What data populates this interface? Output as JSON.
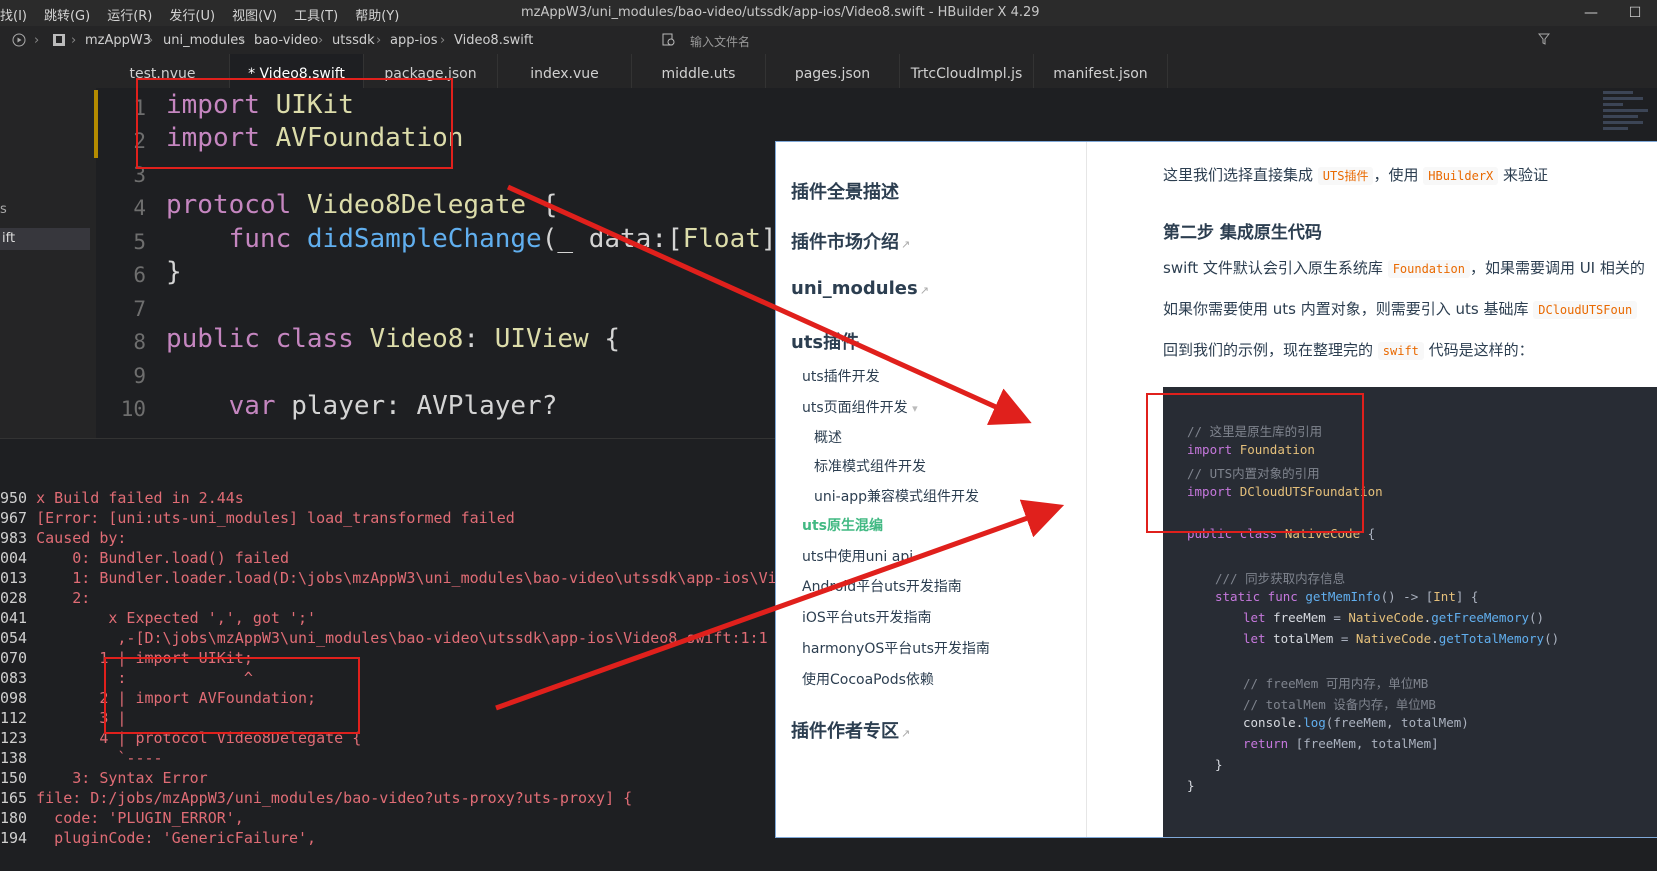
{
  "menu": [
    "找(I)",
    "跳转(G)",
    "运行(R)",
    "发行(U)",
    "视图(V)",
    "工具(T)",
    "帮助(Y)"
  ],
  "window_title": "mzAppW3/uni_modules/bao-video/utssdk/app-ios/Video8.swift - HBuilder X 4.29",
  "window_controls": {
    "minimize": "—",
    "maximize": "☐"
  },
  "breadcrumb": [
    "mzAppW3",
    "uni_modules",
    "bao-video",
    "utssdk",
    "app-ios",
    "Video8.swift"
  ],
  "search_placeholder": "输入文件名",
  "sidebar": {
    "item_partial": "s",
    "selected_partial": "ift"
  },
  "tabs": [
    "test.nvue",
    "* Video8.swift",
    "package.json",
    "index.vue",
    "middle.uts",
    "pages.json",
    "TrtcCloudImpl.js",
    "manifest.json"
  ],
  "editor": {
    "line_numbers": [
      "1",
      "2",
      "3",
      "4",
      "5",
      "6",
      "7",
      "8",
      "9",
      "10"
    ],
    "lines": {
      "l1_kw": "import",
      "l1_ty": "UIKit",
      "l2_kw": "import",
      "l2_ty": "AVFoundation",
      "l4_kw": "protocol",
      "l4_ty": "Video8Delegate",
      "l4_p": "{",
      "l5_kw": "func",
      "l5_fn": "didSampleChange",
      "l5_a": "(_ ",
      "l5_b": "data",
      "l5_c": ":[",
      "l5_d": "Float",
      "l5_e": "])",
      "l6": "}",
      "l8_kw": "public class",
      "l8_ty": "Video8",
      "l8_c": ":",
      "l8_sup": "UIView",
      "l8_p": "{",
      "l10_kw": "var",
      "l10_v": "player",
      "l10_c": ":",
      "l10_t": "AVPlayer?"
    }
  },
  "console": [
    {
      "n": "950",
      "t": " x Build failed in 2.44s"
    },
    {
      "n": "967",
      "t": " [Error: [uni:uts-uni_modules] load_transformed failed"
    },
    {
      "n": "983",
      "t": " Caused by:"
    },
    {
      "n": "004",
      "t": "     0: Bundler.load() failed"
    },
    {
      "n": "013",
      "t": "     1: Bundler.loader.load(D:\\jobs\\mzAppW3\\uni_modules\\bao-video\\utssdk\\app-ios\\Vi"
    },
    {
      "n": "028",
      "t": "     2:"
    },
    {
      "n": "041",
      "t": "         x Expected ',', got ';'"
    },
    {
      "n": "054",
      "t": "          ,-[D:\\jobs\\mzAppW3\\uni_modules\\bao-video\\utssdk\\app-ios\\Video8.swift:1:1"
    },
    {
      "n": "070",
      "t": "        1 | import UIKit;"
    },
    {
      "n": "083",
      "t": "          :             ^"
    },
    {
      "n": "098",
      "t": "        2 | import AVFoundation;"
    },
    {
      "n": "112",
      "t": "        3 |"
    },
    {
      "n": "123",
      "t": "        4 | protocol Video8Delegate {"
    },
    {
      "n": "138",
      "t": "          `----"
    },
    {
      "n": "150",
      "t": "     3: Syntax Error"
    },
    {
      "n": "165",
      "t": " file: D:/jobs/mzAppW3/uni_modules/bao-video?uts-proxy?uts-proxy] {"
    },
    {
      "n": "180",
      "t": "   code: 'PLUGIN_ERROR',"
    },
    {
      "n": "194",
      "t": "   pluginCode: 'GenericFailure',"
    }
  ],
  "docs": {
    "nav": {
      "h1": "插件全景描述",
      "h2": "插件市场介绍",
      "h3": "uni_modules",
      "h4": "uts插件",
      "items": [
        "uts插件开发",
        "uts页面组件开发",
        "概述",
        "标准模式组件开发",
        "uni-app兼容模式组件开发",
        "uts原生混编",
        "uts中使用uni api",
        "Android平台uts开发指南",
        "iOS平台uts开发指南",
        "harmonyOS平台uts开发指南",
        "使用CocoaPods依赖"
      ],
      "h5": "插件作者专区",
      "ext_icon": "↗",
      "caret": "▾"
    },
    "content": {
      "p1_a": "这里我们选择直接集成 ",
      "p1_code": "UTS插件",
      "p1_b": "，使用 ",
      "p1_code2": "HBuilderX",
      "p1_c": " 来验证",
      "h_step2": "第二步 集成原生代码",
      "p2_a": "swift 文件默认会引入原生系统库 ",
      "p2_code": "Foundation",
      "p2_b": "，如果需要调用 UI 相关的",
      "p3_a": "如果你需要使用 uts 内置对象，则需要引入 uts 基础库 ",
      "p3_code": "DCloudUTSFoun",
      "p4_a": "回到我们的示例，现在整理完的 ",
      "p4_code": "swift",
      "p4_b": " 代码是这样的：",
      "code": {
        "c1": "// 这里是原生库的引用",
        "c2_k": "import",
        "c2_t": "Foundation",
        "c3": "// UTS内置对象的引用",
        "c4_k": "import",
        "c4_t": "DCloudUTSFoundation",
        "c5_k": "public class",
        "c5_t": "NativeCode",
        "c5_p": "{",
        "c6": "/// 同步获取内存信息",
        "c7_k": "static func",
        "c7_f": "getMemInfo",
        "c7_p": "() -> [",
        "c7_t": "Int",
        "c7_q": "] {",
        "c8_k": "let",
        "c8_v": "freeMem",
        "c8_p": "=",
        "c8_t": "NativeCode",
        "c8_f": "getFreeMemory",
        "c8_q": "()",
        "c9_k": "let",
        "c9_v": "totalMem",
        "c9_p": "=",
        "c9_t": "NativeCode",
        "c9_f": "getTotalMemory",
        "c9_q": "()",
        "c10": "// freeMem 可用内存，单位MB",
        "c11": "// totalMem 设备内存，单位MB",
        "c12_v": "console",
        "c12_f": "log",
        "c12_p": "(freeMem, totalMem)",
        "c13_k": "return",
        "c13_p": "[freeMem, totalMem]",
        "c14": "}",
        "c15": "}"
      }
    }
  },
  "colors": {
    "accent_red": "#e0201c",
    "docs_active": "#42b983"
  }
}
